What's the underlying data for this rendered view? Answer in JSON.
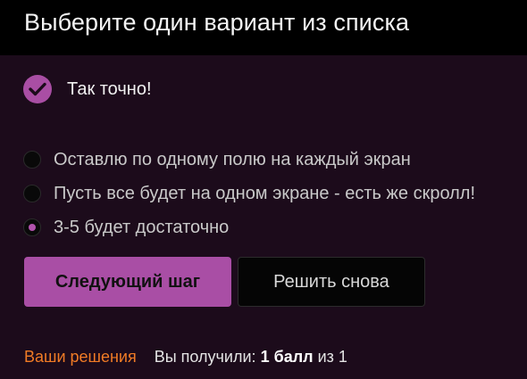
{
  "header": {
    "title": "Выберите один вариант из списка"
  },
  "feedback": {
    "icon": "check-icon",
    "text": "Так точно!"
  },
  "options": [
    {
      "label": "Оставлю по одному полю на каждый экран",
      "selected": false
    },
    {
      "label": "Пусть все будет на одном экране - есть же скролл!",
      "selected": false
    },
    {
      "label": "3-5 будет достаточно",
      "selected": true
    }
  ],
  "buttons": {
    "next_label": "Следующий шаг",
    "retry_label": "Решить снова"
  },
  "footer": {
    "solutions_link": "Ваши решения",
    "score_prefix": "Вы получили:",
    "score_value": "1 балл",
    "score_separator": "из",
    "score_max": "1"
  },
  "colors": {
    "background": "#1c0b1b",
    "header_background": "#000000",
    "accent": "#a94ea5",
    "link": "#f07b25"
  }
}
